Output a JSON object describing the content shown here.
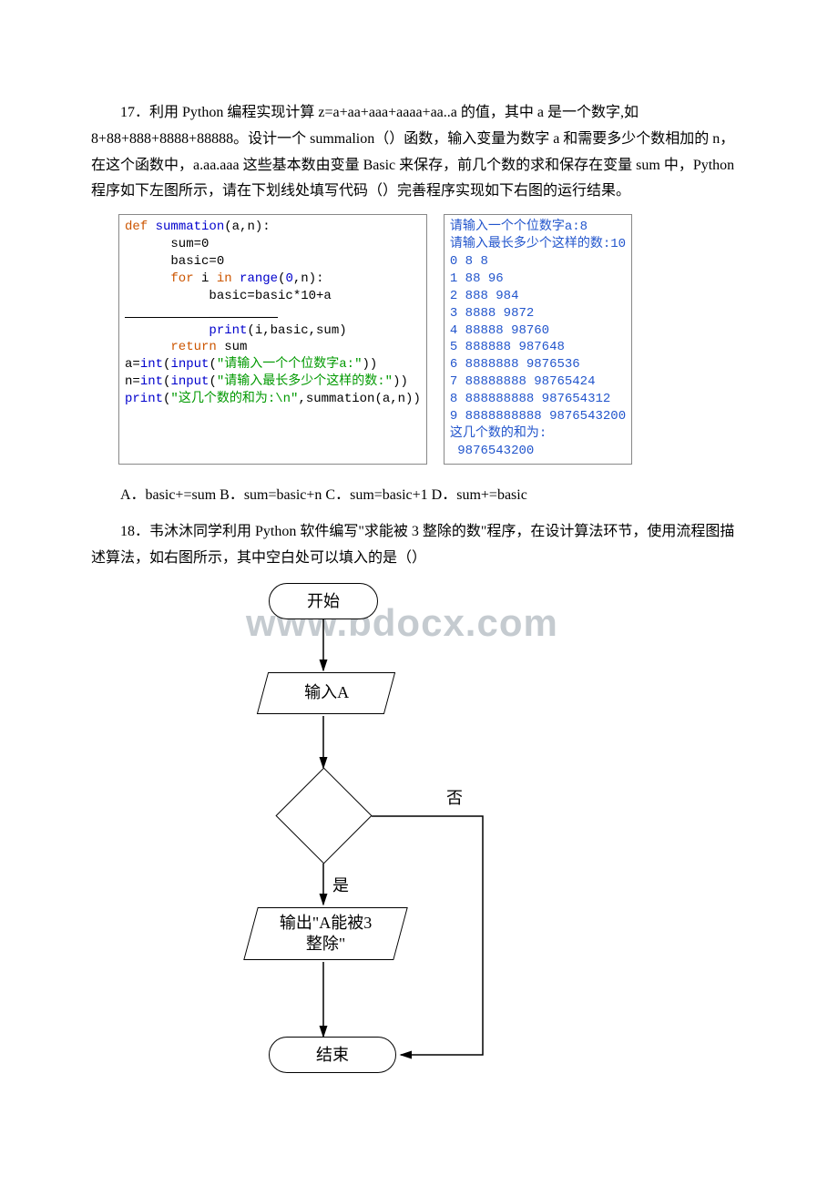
{
  "q17": {
    "prompt": "17．利用 Python 编程实现计算 z=a+aa+aaa+aaaa+aa..a 的值，其中 a 是一个数字,如8+88+888+8888+88888。设计一个 summalion（）函数，输入变量为数字 a 和需要多少个数相加的 n，在这个函数中，a.aa.aaa 这些基本数由变量 Basic 来保存，前几个数的求和保存在变量 sum 中，Python 程序如下左图所示，请在下划线处填写代码（）完善程序实现如下右图的运行结果。",
    "code": {
      "l1a": "def",
      "l1b": " summation",
      "l1c": "(a,n):",
      "l2": "      sum=0",
      "l3": "      basic=0",
      "l4a": "      for",
      "l4b": " i ",
      "l4c": "in",
      "l4d": " range",
      "l4e": "(",
      "l4f": "0",
      "l4g": ",n):",
      "l5": "           basic=basic*10+a",
      "l6": "           _________",
      "l7a": "           print",
      "l7b": "(i,basic,sum)",
      "l8a": "      return",
      "l8b": " sum",
      "l9a": "a=",
      "l9b": "int",
      "l9c": "(",
      "l9d": "input",
      "l9e": "(",
      "l9f": "\"请输入一个个位数字a:\"",
      "l9g": "))",
      "l10a": "n=",
      "l10b": "int",
      "l10c": "(",
      "l10d": "input",
      "l10e": "(",
      "l10f": "\"请输入最长多少个这样的数:\"",
      "l10g": "))",
      "l11a": "print",
      "l11b": "(",
      "l11c": "\"这几个数的和为:\\n\"",
      "l11d": ",summation(a,n))"
    },
    "output": {
      "p1": "请输入一个个位数字a:8",
      "p2": "请输入最长多少个这样的数:10",
      "r0": "0 8 8",
      "r1": "1 88 96",
      "r2": "2 888 984",
      "r3": "3 8888 9872",
      "r4": "4 88888 98760",
      "r5": "5 888888 987648",
      "r6": "6 8888888 9876536",
      "r7": "7 88888888 98765424",
      "r8": "8 888888888 987654312",
      "r9": "9 8888888888 9876543200",
      "f1": "这几个数的和为:",
      "f2": " 9876543200"
    },
    "options": "A．basic+=sum B．sum=basic+n C．sum=basic+1 D．sum+=basic"
  },
  "q18": {
    "prompt": "18．韦沐沐同学利用 Python 软件编写\"求能被 3 整除的数\"程序，在设计算法环节，使用流程图描述算法，如右图所示，其中空白处可以填入的是（）",
    "flow": {
      "start": "开始",
      "input": "输入A",
      "no": "否",
      "yes": "是",
      "output": "输出\"A能被3\n整除\"",
      "end": "结束"
    }
  },
  "watermark": "www.bdocx.com"
}
